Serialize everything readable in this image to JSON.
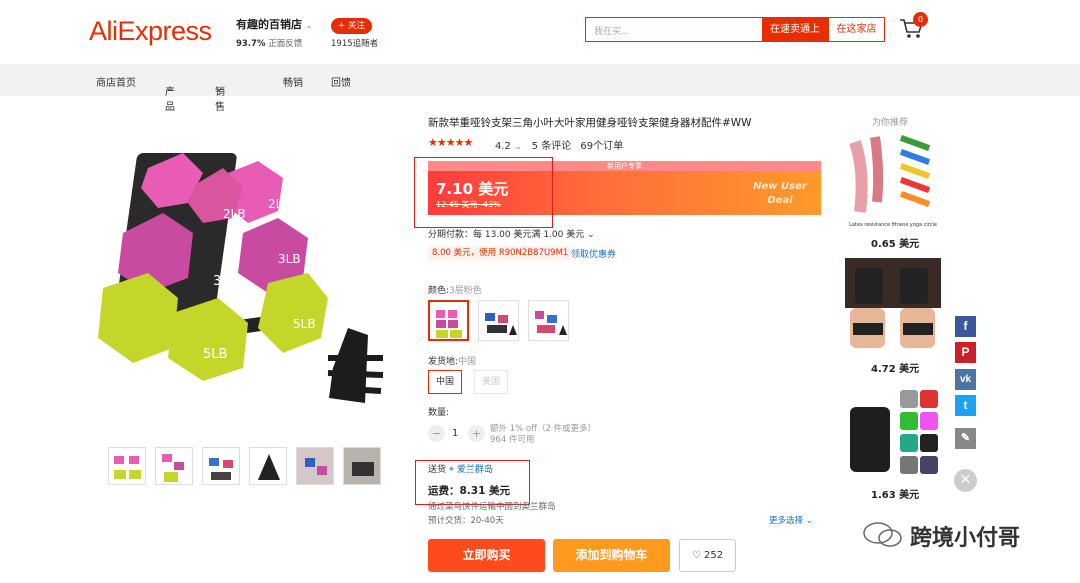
{
  "header": {
    "logo": "AliExpress",
    "store_name": "有趣的百销店",
    "store_feedback_pct": "93.7%",
    "store_feedback_label": "正面反馈",
    "follow_label": "+ 关注",
    "followers": "1915追随者",
    "search_placeholder": "我在买...",
    "search_site_label": "在速卖通上",
    "search_store_label": "在这家店",
    "cart_count": "0"
  },
  "nav": {
    "items": [
      "商店首页",
      "产品",
      "销售物品",
      "畅销",
      "回馈"
    ]
  },
  "product": {
    "title": "新款举重哑铃支架三角小叶大叶家用健身哑铃支架健身器材配件#WW",
    "stars": "★★★★★",
    "rating": "4.2",
    "reviews": "5 条评论",
    "orders": "69个订单",
    "banner_note": "新用户专享",
    "price": "7.10 美元",
    "old_price": "12.45 美元",
    "discount": "-43%",
    "deal_line1": "New User",
    "deal_line2": "Deal",
    "installment": "分期付款：每 13.00 美元满 1.00 美元",
    "coupon": "8.00 美元，使用 R90N2B87U9M1",
    "coupon_link": "领取优惠券",
    "color_label": "颜色:",
    "color_value": "3层粉色",
    "ship_from_label": "发货地:",
    "ship_from_value": "中国",
    "ship_from_options": [
      "中国",
      "美国"
    ],
    "qty_label": "数量:",
    "qty_minus": "−",
    "qty_value": "1",
    "qty_plus": "+",
    "qty_note1": "额外 1% off（2 件或更多）",
    "qty_note2": "964 件可用",
    "ship_to_label": "送货",
    "ship_to_value": "爱兰群岛",
    "shipping_fee": "运费：8.31 美元",
    "shipping_method": "通过菜鸟快件运输中国到奥兰群岛",
    "delivery_time": "预计交货：20-40天",
    "more_options": "更多选择",
    "buy_now": "立即购买",
    "add_to_cart": "添加到购物车",
    "wishlist_count": "252"
  },
  "recommend": {
    "title": "为你推荐",
    "items": [
      {
        "price": "0.65 美元",
        "caption": "Latex resistance fitness yoga circle"
      },
      {
        "price": "4.72 美元"
      },
      {
        "price": "1.63 美元"
      }
    ]
  },
  "social": [
    "f",
    "P",
    "vk",
    "t",
    "✎"
  ],
  "watermark": "跨境小付哥",
  "colors": {
    "brand": "#e62e04",
    "link": "#1a70c9",
    "highlight_box": "#e31c1c"
  }
}
